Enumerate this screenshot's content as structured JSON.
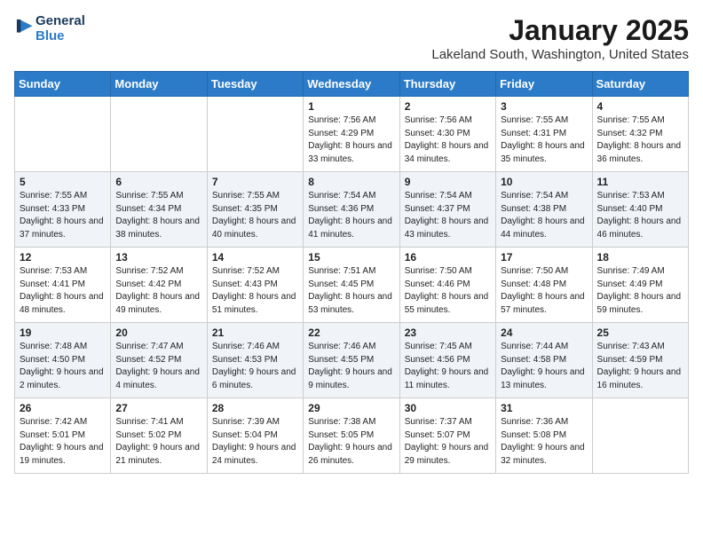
{
  "header": {
    "logo_line1": "General",
    "logo_line2": "Blue",
    "month": "January 2025",
    "location": "Lakeland South, Washington, United States"
  },
  "weekdays": [
    "Sunday",
    "Monday",
    "Tuesday",
    "Wednesday",
    "Thursday",
    "Friday",
    "Saturday"
  ],
  "weeks": [
    [
      {
        "day": "",
        "sunrise": "",
        "sunset": "",
        "daylight": ""
      },
      {
        "day": "",
        "sunrise": "",
        "sunset": "",
        "daylight": ""
      },
      {
        "day": "",
        "sunrise": "",
        "sunset": "",
        "daylight": ""
      },
      {
        "day": "1",
        "sunrise": "7:56 AM",
        "sunset": "4:29 PM",
        "daylight": "8 hours and 33 minutes."
      },
      {
        "day": "2",
        "sunrise": "7:56 AM",
        "sunset": "4:30 PM",
        "daylight": "8 hours and 34 minutes."
      },
      {
        "day": "3",
        "sunrise": "7:55 AM",
        "sunset": "4:31 PM",
        "daylight": "8 hours and 35 minutes."
      },
      {
        "day": "4",
        "sunrise": "7:55 AM",
        "sunset": "4:32 PM",
        "daylight": "8 hours and 36 minutes."
      }
    ],
    [
      {
        "day": "5",
        "sunrise": "7:55 AM",
        "sunset": "4:33 PM",
        "daylight": "8 hours and 37 minutes."
      },
      {
        "day": "6",
        "sunrise": "7:55 AM",
        "sunset": "4:34 PM",
        "daylight": "8 hours and 38 minutes."
      },
      {
        "day": "7",
        "sunrise": "7:55 AM",
        "sunset": "4:35 PM",
        "daylight": "8 hours and 40 minutes."
      },
      {
        "day": "8",
        "sunrise": "7:54 AM",
        "sunset": "4:36 PM",
        "daylight": "8 hours and 41 minutes."
      },
      {
        "day": "9",
        "sunrise": "7:54 AM",
        "sunset": "4:37 PM",
        "daylight": "8 hours and 43 minutes."
      },
      {
        "day": "10",
        "sunrise": "7:54 AM",
        "sunset": "4:38 PM",
        "daylight": "8 hours and 44 minutes."
      },
      {
        "day": "11",
        "sunrise": "7:53 AM",
        "sunset": "4:40 PM",
        "daylight": "8 hours and 46 minutes."
      }
    ],
    [
      {
        "day": "12",
        "sunrise": "7:53 AM",
        "sunset": "4:41 PM",
        "daylight": "8 hours and 48 minutes."
      },
      {
        "day": "13",
        "sunrise": "7:52 AM",
        "sunset": "4:42 PM",
        "daylight": "8 hours and 49 minutes."
      },
      {
        "day": "14",
        "sunrise": "7:52 AM",
        "sunset": "4:43 PM",
        "daylight": "8 hours and 51 minutes."
      },
      {
        "day": "15",
        "sunrise": "7:51 AM",
        "sunset": "4:45 PM",
        "daylight": "8 hours and 53 minutes."
      },
      {
        "day": "16",
        "sunrise": "7:50 AM",
        "sunset": "4:46 PM",
        "daylight": "8 hours and 55 minutes."
      },
      {
        "day": "17",
        "sunrise": "7:50 AM",
        "sunset": "4:48 PM",
        "daylight": "8 hours and 57 minutes."
      },
      {
        "day": "18",
        "sunrise": "7:49 AM",
        "sunset": "4:49 PM",
        "daylight": "8 hours and 59 minutes."
      }
    ],
    [
      {
        "day": "19",
        "sunrise": "7:48 AM",
        "sunset": "4:50 PM",
        "daylight": "9 hours and 2 minutes."
      },
      {
        "day": "20",
        "sunrise": "7:47 AM",
        "sunset": "4:52 PM",
        "daylight": "9 hours and 4 minutes."
      },
      {
        "day": "21",
        "sunrise": "7:46 AM",
        "sunset": "4:53 PM",
        "daylight": "9 hours and 6 minutes."
      },
      {
        "day": "22",
        "sunrise": "7:46 AM",
        "sunset": "4:55 PM",
        "daylight": "9 hours and 9 minutes."
      },
      {
        "day": "23",
        "sunrise": "7:45 AM",
        "sunset": "4:56 PM",
        "daylight": "9 hours and 11 minutes."
      },
      {
        "day": "24",
        "sunrise": "7:44 AM",
        "sunset": "4:58 PM",
        "daylight": "9 hours and 13 minutes."
      },
      {
        "day": "25",
        "sunrise": "7:43 AM",
        "sunset": "4:59 PM",
        "daylight": "9 hours and 16 minutes."
      }
    ],
    [
      {
        "day": "26",
        "sunrise": "7:42 AM",
        "sunset": "5:01 PM",
        "daylight": "9 hours and 19 minutes."
      },
      {
        "day": "27",
        "sunrise": "7:41 AM",
        "sunset": "5:02 PM",
        "daylight": "9 hours and 21 minutes."
      },
      {
        "day": "28",
        "sunrise": "7:39 AM",
        "sunset": "5:04 PM",
        "daylight": "9 hours and 24 minutes."
      },
      {
        "day": "29",
        "sunrise": "7:38 AM",
        "sunset": "5:05 PM",
        "daylight": "9 hours and 26 minutes."
      },
      {
        "day": "30",
        "sunrise": "7:37 AM",
        "sunset": "5:07 PM",
        "daylight": "9 hours and 29 minutes."
      },
      {
        "day": "31",
        "sunrise": "7:36 AM",
        "sunset": "5:08 PM",
        "daylight": "9 hours and 32 minutes."
      },
      {
        "day": "",
        "sunrise": "",
        "sunset": "",
        "daylight": ""
      }
    ]
  ]
}
